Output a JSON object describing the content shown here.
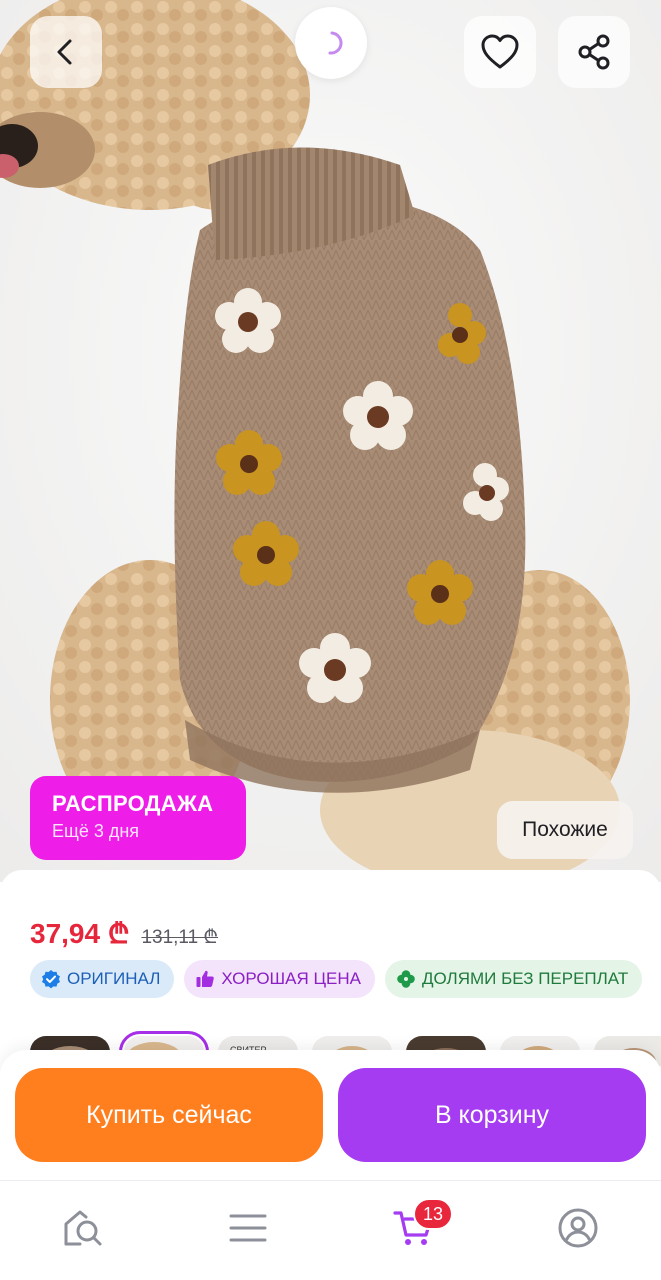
{
  "header": {
    "back_icon": "chevron-left-icon",
    "loader_icon": "spinner-icon",
    "favorite_icon": "heart-icon",
    "share_icon": "share-icon"
  },
  "gallery": {
    "sale_badge": {
      "title": "РАСПРОДАЖА",
      "subtitle": "Ещё 3 дня",
      "color": "#ee1ee8"
    },
    "similar_label": "Похожие",
    "thumbnail_count": 7,
    "active_thumbnail": 2
  },
  "product": {
    "price": "37,94 ₾",
    "old_price": "131,11 ₾",
    "price_color": "#e6263b"
  },
  "chips": [
    {
      "label": "ОРИГИНАЛ",
      "icon": "verified-badge-icon"
    },
    {
      "label": "ХОРОШАЯ ЦЕНА",
      "icon": "thumbs-up-icon"
    },
    {
      "label": "ДОЛЯМИ БЕЗ ПЕРЕПЛАТ",
      "icon": "clover-icon"
    }
  ],
  "thumbnail_caption": "СВИТЕР",
  "actions": {
    "buy_now": "Купить сейчас",
    "add_to_cart": "В корзину",
    "buy_color": "#ff7f1f",
    "cart_color": "#a53cf2"
  },
  "bottom_nav": {
    "items": [
      {
        "name": "home",
        "icon": "home-search-icon"
      },
      {
        "name": "catalog",
        "icon": "menu-icon"
      },
      {
        "name": "cart",
        "icon": "cart-icon"
      },
      {
        "name": "profile",
        "icon": "user-icon"
      }
    ],
    "cart_count": "13",
    "active_color": "#a53cf2"
  }
}
